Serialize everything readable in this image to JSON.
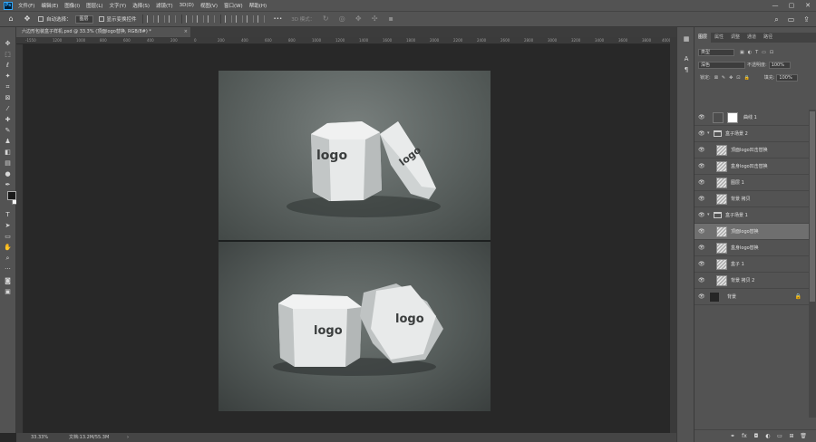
{
  "app": {
    "logo": "Ps"
  },
  "menu": [
    "文件(F)",
    "编辑(E)",
    "图像(I)",
    "图层(L)",
    "文字(Y)",
    "选择(S)",
    "滤镜(T)",
    "3D(D)",
    "视图(V)",
    "窗口(W)",
    "帮助(H)"
  ],
  "window_controls": {
    "minimize": "—",
    "maximize": "▢",
    "close": "✕"
  },
  "options": {
    "auto_select_label": "自动选择：",
    "auto_select_value": "图层",
    "show_transform_label": "显示变换控件",
    "mode_3d_label": "3D 模式：",
    "more": "•••"
  },
  "document_tab": {
    "title": "六边形包装盒子样机.psd @ 33.3% (顶面logo替换, RGB/8#) *",
    "close": "×"
  },
  "ruler_marks": [
    "-1550",
    "1200",
    "1000",
    "800",
    "600",
    "400",
    "200",
    "0",
    "200",
    "400",
    "600",
    "800",
    "1000",
    "1200",
    "1400",
    "1600",
    "1800",
    "2000",
    "2200",
    "2400",
    "2600",
    "2800",
    "3000",
    "3200",
    "3400",
    "3600",
    "3800",
    "4000"
  ],
  "canvas": {
    "logo_text": "logo"
  },
  "status": {
    "zoom": "33.33%",
    "doc_info": "文档:13.2M/55.3M",
    "arrow": "›"
  },
  "panel": {
    "tabs": [
      "图层",
      "属性",
      "调整",
      "通道",
      "路径"
    ],
    "filter_kind": "类型",
    "blend_mode": "深色",
    "opacity_label": "不透明度:",
    "opacity_value": "100%",
    "lock_label": "锁定:",
    "fill_label": "填充:",
    "fill_value": "100%",
    "layers": [
      {
        "name": "曲线 1",
        "type": "adjustment",
        "selected": false
      },
      {
        "name": "盒子场景 2",
        "type": "group",
        "selected": false
      },
      {
        "name": "顶面logo凹击替换",
        "type": "smart",
        "selected": false
      },
      {
        "name": "盒身logo凹击替换",
        "type": "smart",
        "selected": false
      },
      {
        "name": "图层 1",
        "type": "smart",
        "selected": false
      },
      {
        "name": "背景 拷贝",
        "type": "pixel",
        "selected": false
      },
      {
        "name": "盒子场景 1",
        "type": "group",
        "selected": false
      },
      {
        "name": "顶面logo替换",
        "type": "smart",
        "selected": true
      },
      {
        "name": "盒身logo替换",
        "type": "smart",
        "selected": false
      },
      {
        "name": "盒子 1",
        "type": "smart",
        "selected": false
      },
      {
        "name": "背景 拷贝 2",
        "type": "pixel",
        "selected": false
      },
      {
        "name": "背景",
        "type": "background",
        "selected": false
      }
    ],
    "footer_icons": [
      "link-icon",
      "fx-icon",
      "mask-icon",
      "adjustment-icon",
      "folder-icon",
      "new-layer-icon",
      "trash-icon"
    ],
    "footer_labels": [
      "⚭",
      "fx",
      "◘",
      "◐",
      "▭",
      "⊞",
      "🗑"
    ]
  },
  "colors": {
    "foreground": "#1a1a1a",
    "background": "#f5f5f5",
    "ui_panel": "#535353",
    "canvas_bg": "#282828"
  }
}
